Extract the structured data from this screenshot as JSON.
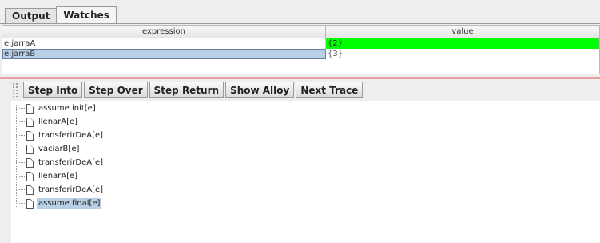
{
  "tabs": [
    {
      "label": "Output",
      "active": false
    },
    {
      "label": "Watches",
      "active": true
    }
  ],
  "watches": {
    "columns": {
      "expression": "expression",
      "value": "value"
    },
    "rows": [
      {
        "expression": "e.jarraA",
        "value": "{2}",
        "highlight": "#00ff00",
        "selected": false
      },
      {
        "expression": "e.jarraB",
        "value": "{3}",
        "highlight": null,
        "selected": true
      }
    ]
  },
  "toolbar": {
    "step_into": "Step Into",
    "step_over": "Step Over",
    "step_return": "Step Return",
    "show_alloy": "Show Alloy",
    "next_trace": "Next Trace"
  },
  "trace": {
    "items": [
      {
        "label": "assume init[e]",
        "selected": false
      },
      {
        "label": "llenarA[e]",
        "selected": false
      },
      {
        "label": "transferirDeA[e]",
        "selected": false
      },
      {
        "label": "vaciarB[e]",
        "selected": false
      },
      {
        "label": "transferirDeA[e]",
        "selected": false
      },
      {
        "label": "llenarA[e]",
        "selected": false
      },
      {
        "label": "transferirDeA[e]",
        "selected": false
      },
      {
        "label": "assume final[e]",
        "selected": true
      }
    ]
  },
  "colors": {
    "changed_value": "#00ff00",
    "selection": "#b8cfe5",
    "splitter": "#e8a0a0"
  }
}
